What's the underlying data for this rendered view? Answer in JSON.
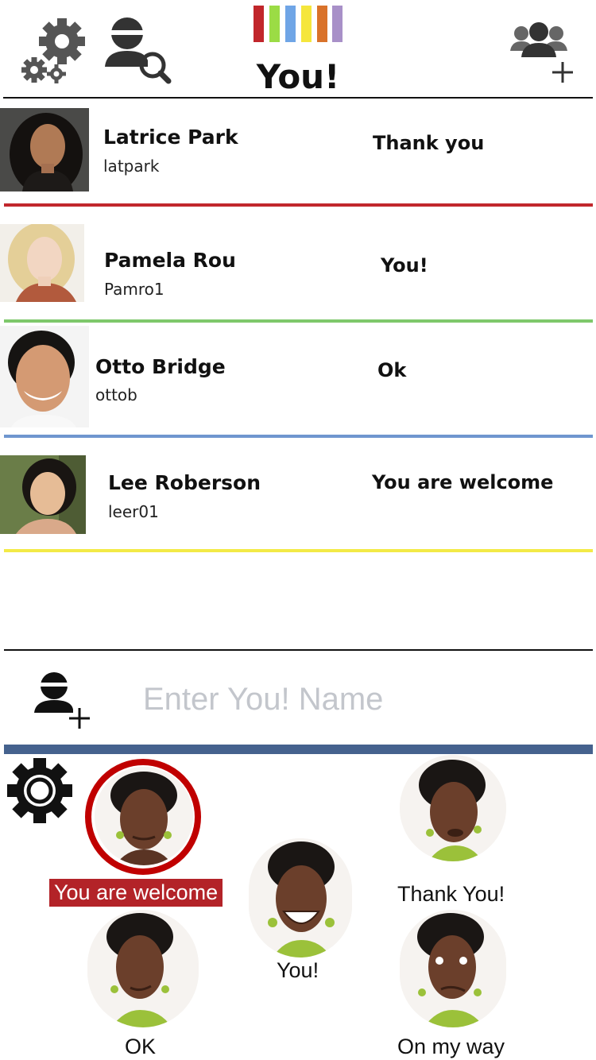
{
  "header": {
    "title": "You!",
    "settings_icon": "gears-icon",
    "search_user_icon": "user-search-icon",
    "add_group_icon": "group-add-icon",
    "logo_colors": [
      "#c1262b",
      "#9bdc45",
      "#6fa5e6",
      "#f5e63c",
      "#d9722a",
      "#a890c8"
    ]
  },
  "conversations": [
    {
      "name": "Latrice Park",
      "handle": "latpark",
      "last_message": "Thank you",
      "color": "#c1272d"
    },
    {
      "name": "Pamela Rou",
      "handle": "Pamro1",
      "last_message": "You!",
      "color": "#7ec86b"
    },
    {
      "name": "Otto Bridge",
      "handle": "ottob",
      "last_message": "Ok",
      "color": "#6f96cf"
    },
    {
      "name": "Lee Roberson",
      "handle": "leer01",
      "last_message": "You are welcome",
      "color": "#f3ea47"
    }
  ],
  "add_contact": {
    "icon": "add-user-icon",
    "placeholder": "Enter You! Name"
  },
  "reactions": {
    "settings_icon": "gear-icon",
    "selected": "You are welcome",
    "items": [
      {
        "label": "You are welcome"
      },
      {
        "label": "Thank You!"
      },
      {
        "label": "You!"
      },
      {
        "label": "OK"
      },
      {
        "label": "On my way"
      }
    ]
  }
}
